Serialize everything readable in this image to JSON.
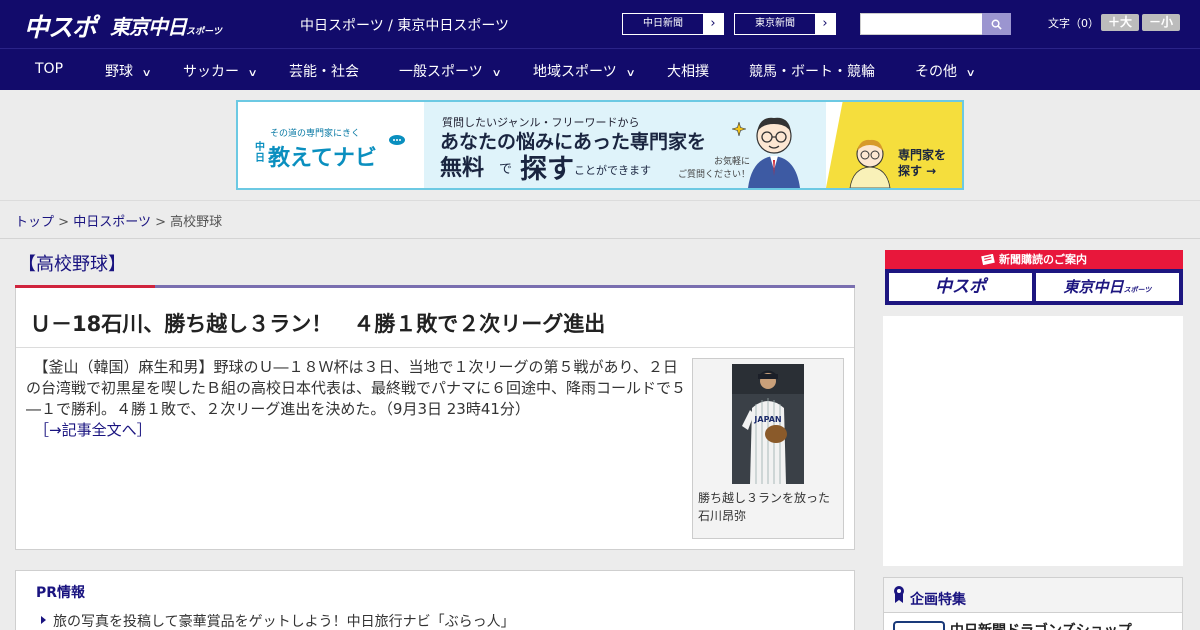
{
  "header": {
    "logo_chuspo": "中スポ",
    "logo_tokyo": "東京中日",
    "logo_tokyo_small": "スポーツ",
    "site_title": "中日スポーツ / 東京中日スポーツ",
    "paper_links": [
      {
        "label": "中日新聞"
      },
      {
        "label": "東京新聞"
      }
    ],
    "search": {
      "value": "",
      "placeholder": ""
    },
    "font_size_label": "文字（0）",
    "font_bigger": "＋大",
    "font_smaller": "－小"
  },
  "nav": {
    "items": [
      {
        "label": "TOP",
        "dropdown": false
      },
      {
        "label": "野球",
        "dropdown": true
      },
      {
        "label": "サッカー",
        "dropdown": true
      },
      {
        "label": "芸能・社会",
        "dropdown": false
      },
      {
        "label": "一般スポーツ",
        "dropdown": true
      },
      {
        "label": "地域スポーツ",
        "dropdown": true
      },
      {
        "label": "大相撲",
        "dropdown": false
      },
      {
        "label": "競馬・ボート・競輪",
        "dropdown": false
      },
      {
        "label": "その他",
        "dropdown": true
      }
    ]
  },
  "banner": {
    "tagline": "その道の専門家にきく",
    "brand_prefix": "中日",
    "brand": "教えてナビ",
    "line1": "質問したいジャンル・フリーワードから",
    "line2": "あなたの悩みにあった専門家を",
    "line3a": "無料",
    "line3b": "で",
    "line3c": "探す",
    "line3d": "ことができます",
    "note": "お気軽に\nご質問ください！",
    "cta": "専門家を\n探す →"
  },
  "breadcrumb": {
    "items": [
      "トップ",
      "中日スポーツ"
    ],
    "current": "高校野球",
    "separator": ">"
  },
  "article": {
    "category": "【高校野球】",
    "headline": "Ｕ－18石川、勝ち越し３ラン！　４勝１敗で２次リーグ進出",
    "body": "　【釜山（韓国）麻生和男】野球のＵ―１８Ｗ杯は３日、当地で１次リーグの第５戦があり、２日の台湾戦で初黒星を喫したＢ組の高校日本代表は、最終戦でパナマに６回途中、降雨コールドで５―１で勝利。４勝１敗で、２次リーグ進出を決めた。（9月3日 23時41分）",
    "more_link": "［→記事全文へ］",
    "photo_caption": "勝ち越し３ランを放った石川昂弥",
    "jersey_text": "JAPAN"
  },
  "pr": {
    "title": "PR情報",
    "items": [
      "旅の写真を投稿して豪華賞品をゲットしよう！中日旅行ナビ「ぶらっ人」"
    ]
  },
  "sidebar": {
    "subscribe_head": "新聞購読のご案内",
    "subscribe_buttons": [
      "中スポ",
      "東京中日"
    ],
    "subscribe_small": "スポーツ",
    "feature_title": "企画特集",
    "feature_item": "中日新聞ドラゴンズショップ"
  },
  "colors": {
    "brand_navy": "#120b6b",
    "accent_red": "#e8173b",
    "link": "#1a1480",
    "banner_border": "#6cc9e3",
    "banner_yellow": "#f5de3d"
  }
}
